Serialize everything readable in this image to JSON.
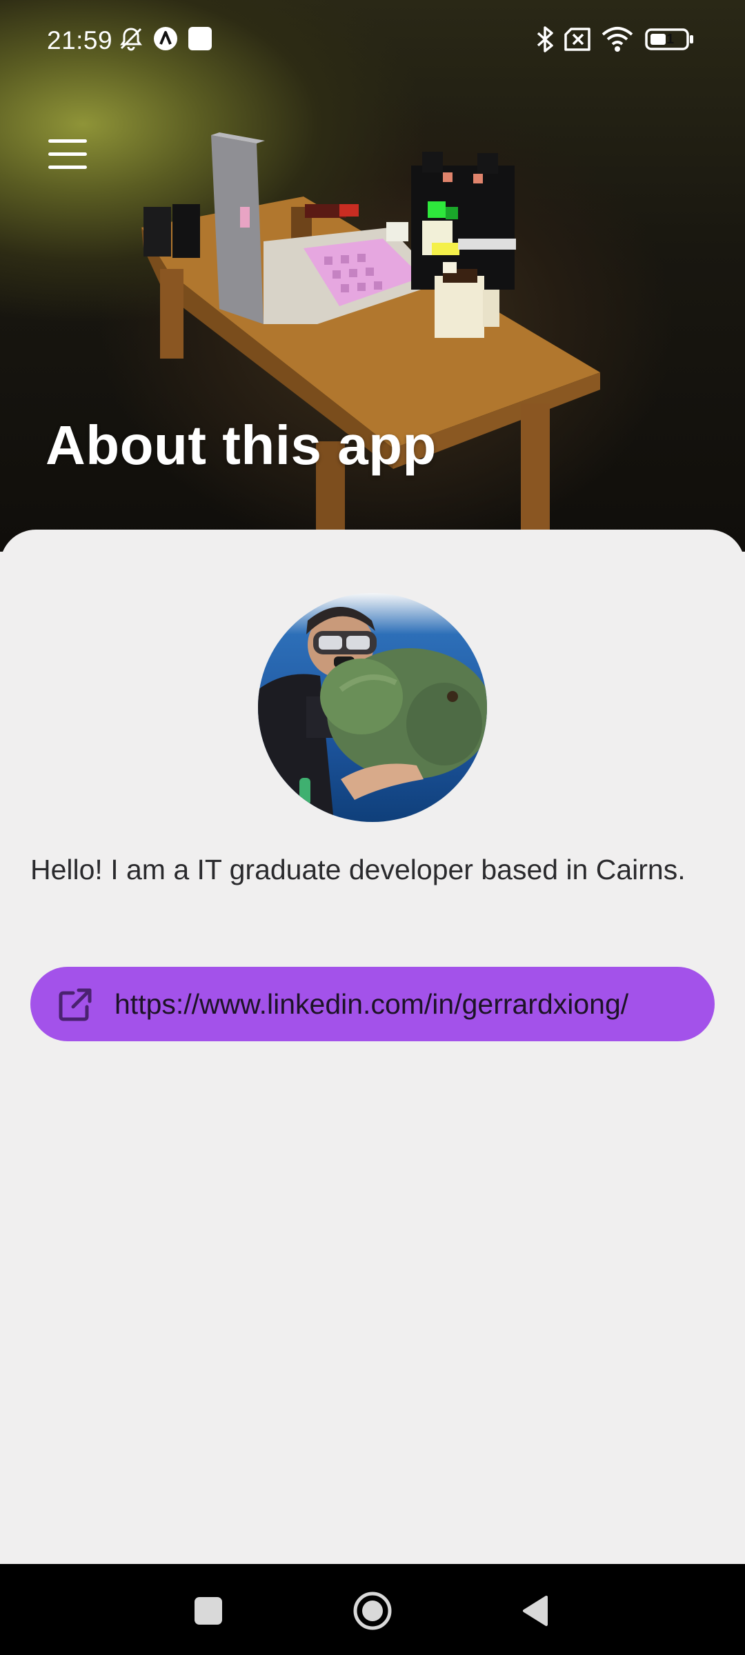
{
  "status_bar": {
    "time": "21:59",
    "left_icons": [
      "bell-off-icon",
      "app-a-icon",
      "app-square-icon"
    ],
    "right_icons": [
      "bluetooth-icon",
      "no-sim-icon",
      "wifi-icon",
      "battery-icon"
    ],
    "battery_level": "1"
  },
  "header": {
    "menu_icon": "hamburger-menu-icon",
    "title": "About this app"
  },
  "profile": {
    "bio": "Hello! I am a IT graduate developer based in Cairns.",
    "link_icon": "external-link-icon",
    "link_text": "https://www.linkedin.com/in/gerrardxiong/"
  },
  "colors": {
    "accent": "#a352ea",
    "background": "#f0efef",
    "text": "#2a2a2d"
  },
  "nav": {
    "icons": [
      "recents-square-icon",
      "home-circle-icon",
      "back-triangle-icon"
    ]
  }
}
